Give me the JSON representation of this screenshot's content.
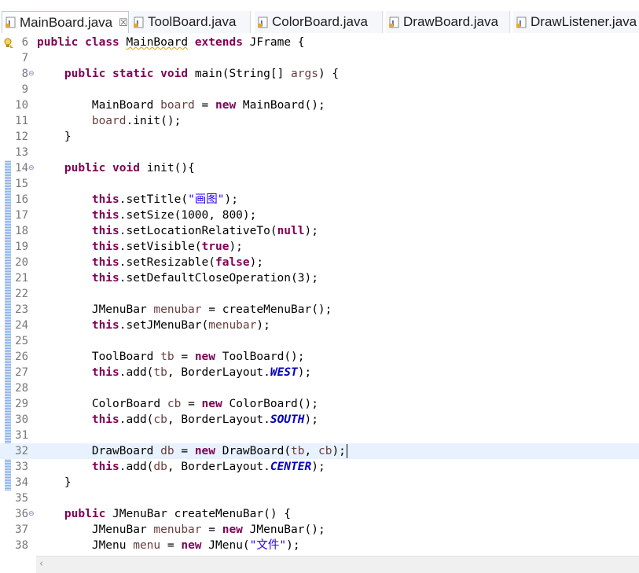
{
  "tabs": [
    {
      "label": "MainBoard.java",
      "active": true,
      "close": "☒"
    },
    {
      "label": "ToolBoard.java",
      "active": false
    },
    {
      "label": "ColorBoard.java",
      "active": false
    },
    {
      "label": "DrawBoard.java",
      "active": false
    },
    {
      "label": "DrawListener.java",
      "active": false
    }
  ],
  "colors": {
    "keyword": "#7f0055",
    "local_variable": "#6a3e3e",
    "string": "#2a00ff",
    "static_field": "#0000c0",
    "current_line": "#e8f2fe",
    "line_number": "#787878"
  },
  "icons": {
    "java_file": "java-file-icon",
    "warning": "warning-lightbulb-icon",
    "fold": "fold-toggle-icon",
    "scroll_left": "scroll-left-arrow-icon"
  },
  "editor": {
    "current_line": 32,
    "lines": [
      {
        "n": "6",
        "text": "public class MainBoard extends JFrame {"
      },
      {
        "n": "7",
        "text": ""
      },
      {
        "n": "8",
        "text": "    public static void main(String[] args) {"
      },
      {
        "n": "9",
        "text": ""
      },
      {
        "n": "10",
        "text": "        MainBoard board = new MainBoard();"
      },
      {
        "n": "11",
        "text": "        board.init();"
      },
      {
        "n": "12",
        "text": "    }"
      },
      {
        "n": "13",
        "text": ""
      },
      {
        "n": "14",
        "text": "    public void init(){"
      },
      {
        "n": "15",
        "text": ""
      },
      {
        "n": "16",
        "text": "        this.setTitle(\"画图\");"
      },
      {
        "n": "17",
        "text": "        this.setSize(1000, 800);"
      },
      {
        "n": "18",
        "text": "        this.setLocationRelativeTo(null);"
      },
      {
        "n": "19",
        "text": "        this.setVisible(true);"
      },
      {
        "n": "20",
        "text": "        this.setResizable(false);"
      },
      {
        "n": "21",
        "text": "        this.setDefaultCloseOperation(3);"
      },
      {
        "n": "22",
        "text": ""
      },
      {
        "n": "23",
        "text": "        JMenuBar menubar = createMenuBar();"
      },
      {
        "n": "24",
        "text": "        this.setJMenuBar(menubar);"
      },
      {
        "n": "25",
        "text": ""
      },
      {
        "n": "26",
        "text": "        ToolBoard tb = new ToolBoard();"
      },
      {
        "n": "27",
        "text": "        this.add(tb, BorderLayout.WEST);"
      },
      {
        "n": "28",
        "text": ""
      },
      {
        "n": "29",
        "text": "        ColorBoard cb = new ColorBoard();"
      },
      {
        "n": "30",
        "text": "        this.add(cb, BorderLayout.SOUTH);"
      },
      {
        "n": "31",
        "text": ""
      },
      {
        "n": "32",
        "text": "        DrawBoard db = new DrawBoard(tb, cb);"
      },
      {
        "n": "33",
        "text": "        this.add(db, BorderLayout.CENTER);"
      },
      {
        "n": "34",
        "text": "    }"
      },
      {
        "n": "35",
        "text": ""
      },
      {
        "n": "36",
        "text": "    public JMenuBar createMenuBar() {"
      },
      {
        "n": "37",
        "text": "        JMenuBar menubar = new JMenuBar();"
      },
      {
        "n": "38",
        "text": "        JMenu menu = new JMenu(\"文件\");"
      }
    ]
  }
}
